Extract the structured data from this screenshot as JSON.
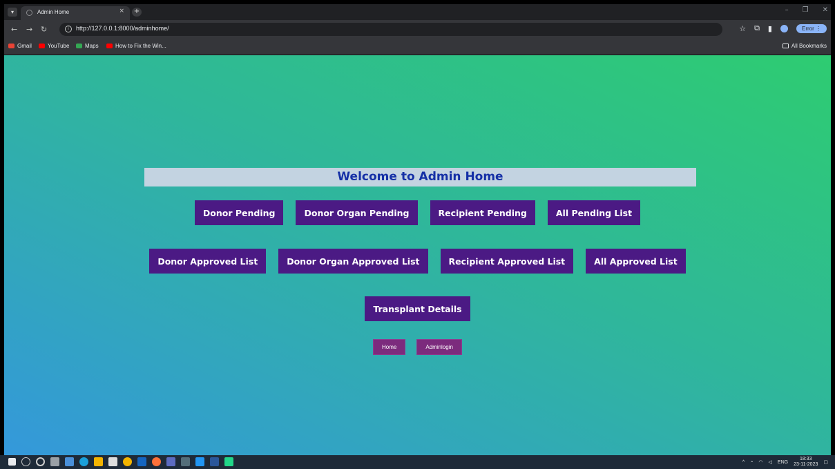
{
  "browser": {
    "tab_title": "Admin Home",
    "tab_close": "×",
    "new_tab": "+",
    "url": "http://127.0.0.1:8000/adminhome/",
    "error_chip": "Error",
    "bookmarks": [
      "Gmail",
      "YouTube",
      "Maps",
      "How to Fix the Win..."
    ],
    "all_bookmarks": "All Bookmarks",
    "window_controls": [
      "–",
      "❐",
      "✕"
    ]
  },
  "page": {
    "welcome": "Welcome to Admin Home",
    "row1": [
      "Donor Pending",
      "Donor Organ Pending",
      "Recipient Pending",
      "All Pending List"
    ],
    "row2": [
      "Donor Approved List",
      "Donor Organ Approved List",
      "Recipient Approved List",
      "All Approved List"
    ],
    "row3": [
      "Transplant Details"
    ],
    "links": [
      "Home",
      "Adminlogin"
    ]
  },
  "taskbar": {
    "lang": "ENG",
    "time": "18:33",
    "date": "23-11-2023"
  },
  "colors": {
    "button_bg": "#4b1a84",
    "link_button_bg": "#7c2b7d",
    "welcome_text": "#1530a6",
    "welcome_bar": "#c3d3e1"
  }
}
